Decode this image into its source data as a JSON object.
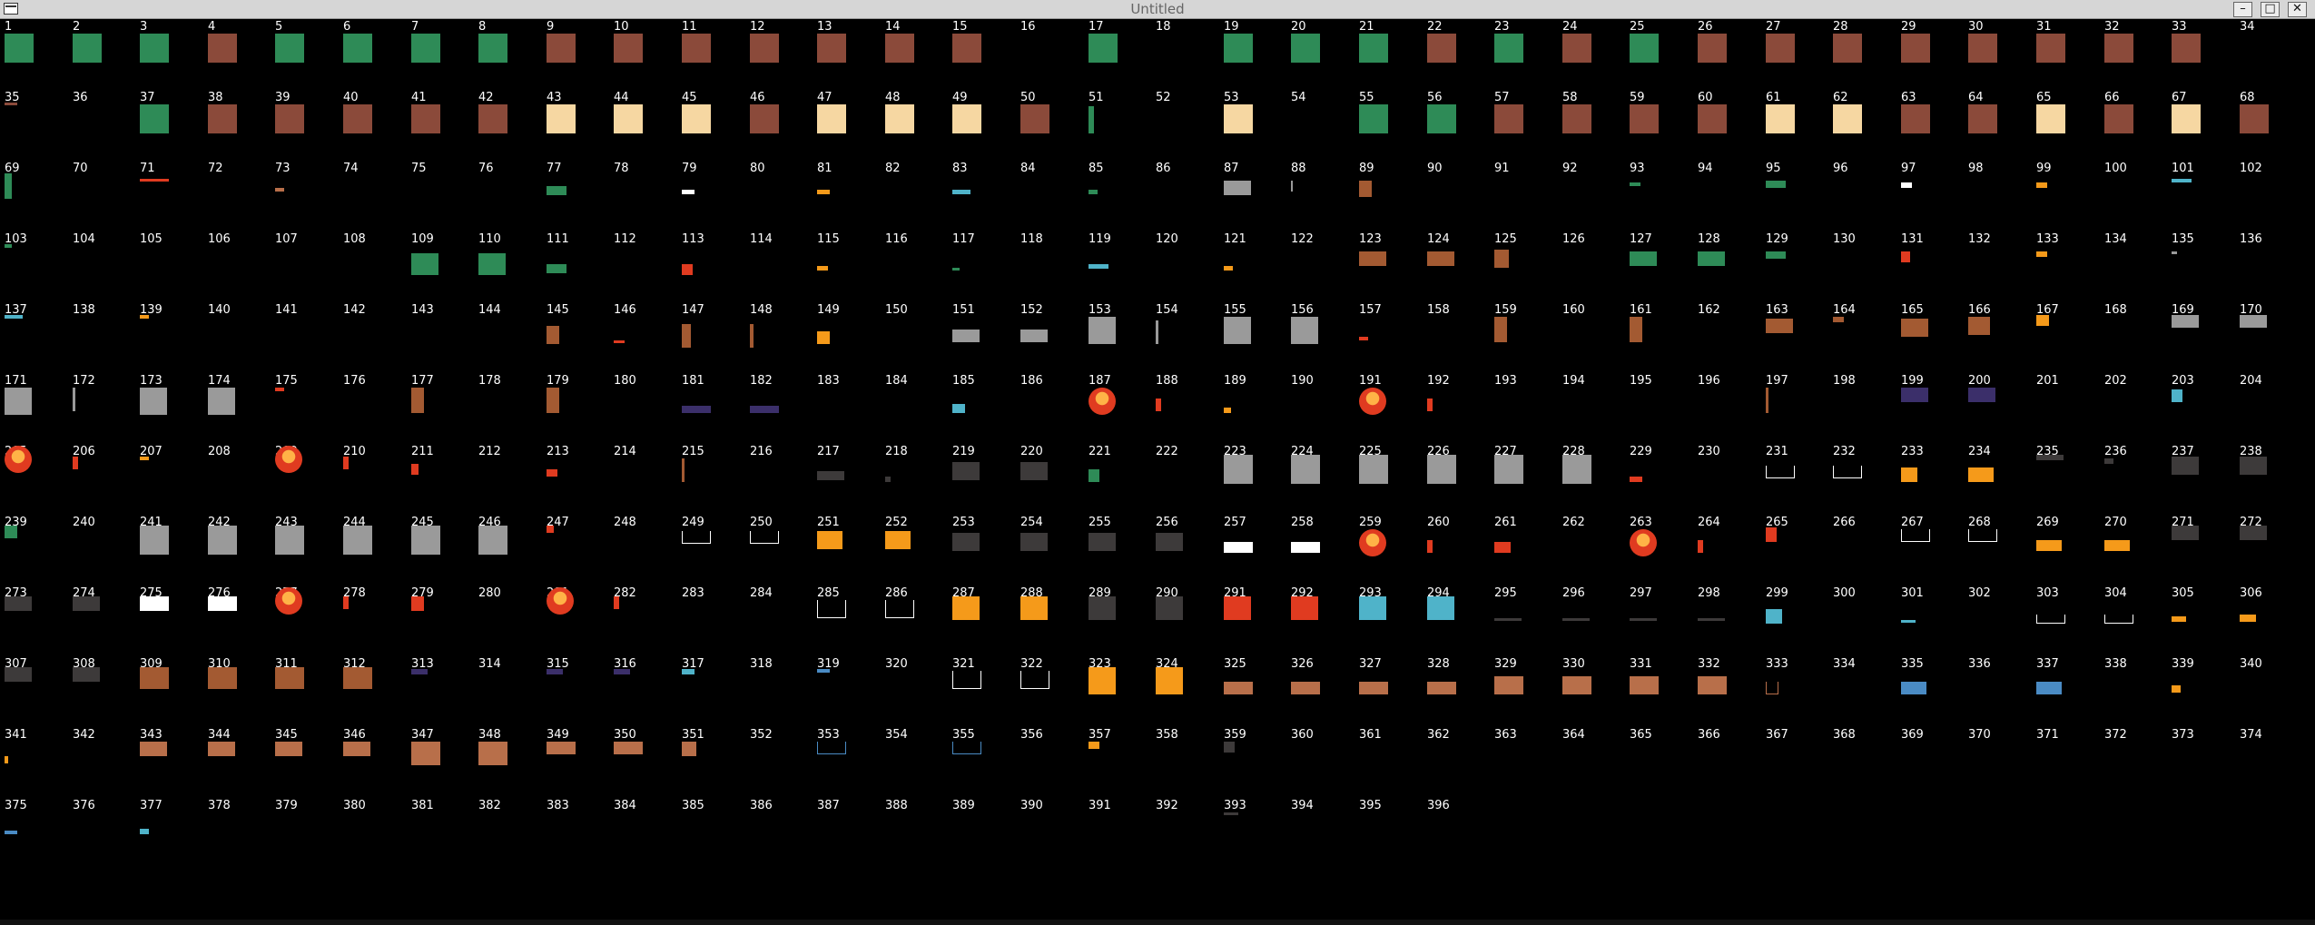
{
  "window": {
    "title": "Untitled",
    "controls": [
      "–",
      "□",
      "✕"
    ]
  },
  "grid": {
    "columns": 34,
    "rows": 12,
    "cell_labels": [
      "1",
      "2",
      "3",
      "4",
      "5",
      "6",
      "7",
      "8",
      "9",
      "10",
      "11",
      "12",
      "13",
      "14",
      "15",
      "16",
      "17",
      "18",
      "19",
      "20",
      "21",
      "22",
      "23",
      "24",
      "25",
      "26",
      "27",
      "28",
      "29",
      "30",
      "31",
      "32",
      "33",
      "34",
      "35",
      "36",
      "37",
      "38",
      "39",
      "40",
      "41",
      "42",
      "43",
      "44",
      "45",
      "46",
      "47",
      "48",
      "49",
      "50",
      "51",
      "52",
      "53",
      "54",
      "55",
      "56",
      "57",
      "58",
      "59",
      "60",
      "61",
      "62",
      "63",
      "64",
      "65",
      "66",
      "67",
      "68",
      "69",
      "70",
      "71",
      "72",
      "73",
      "74",
      "75",
      "76",
      "77",
      "78",
      "79",
      "80",
      "81",
      "82",
      "83",
      "84",
      "85",
      "86",
      "87",
      "88",
      "89",
      "90",
      "91",
      "92",
      "93",
      "94",
      "95",
      "96",
      "97",
      "98",
      "99",
      "100",
      "101",
      "102",
      "103",
      "104",
      "105",
      "106",
      "107",
      "108",
      "109",
      "110",
      "111",
      "112",
      "113",
      "114",
      "115",
      "116",
      "117",
      "118",
      "119",
      "120",
      "121",
      "122",
      "123",
      "124",
      "125",
      "126",
      "127",
      "128",
      "129",
      "130",
      "131",
      "132",
      "133",
      "134",
      "135",
      "136",
      "137",
      "138",
      "139",
      "140",
      "141",
      "142",
      "143",
      "144",
      "145",
      "146",
      "147",
      "148",
      "149",
      "150",
      "151",
      "152",
      "153",
      "154",
      "155",
      "156",
      "157",
      "158",
      "159",
      "160",
      "161",
      "162",
      "163",
      "164",
      "165",
      "166",
      "167",
      "168",
      "169",
      "170",
      "171",
      "172",
      "173",
      "174",
      "175",
      "176",
      "177",
      "178",
      "179",
      "180",
      "181",
      "182",
      "183",
      "184",
      "185",
      "186",
      "187",
      "188",
      "189",
      "190",
      "191",
      "192",
      "193",
      "194",
      "195",
      "196",
      "197",
      "198",
      "199",
      "200",
      "201",
      "202",
      "203",
      "204",
      "205",
      "206",
      "207",
      "208",
      "209",
      "210",
      "211",
      "212",
      "213",
      "214",
      "215",
      "216",
      "217",
      "218",
      "219",
      "220",
      "221",
      "222",
      "223",
      "224",
      "225",
      "226",
      "227",
      "228",
      "229",
      "230",
      "231",
      "232",
      "233",
      "234",
      "235",
      "236",
      "237",
      "238",
      "239",
      "240",
      "241",
      "242",
      "243",
      "244",
      "245",
      "246",
      "247",
      "248",
      "249",
      "250",
      "251",
      "252",
      "253",
      "254",
      "255",
      "256",
      "257",
      "258",
      "259",
      "260",
      "261",
      "262",
      "263",
      "264",
      "265",
      "266",
      "267",
      "268",
      "269",
      "270",
      "271",
      "272",
      "273",
      "274",
      "275",
      "276",
      "277",
      "278",
      "279",
      "280",
      "281",
      "282",
      "283",
      "284",
      "285",
      "286",
      "287",
      "288",
      "289",
      "290",
      "291",
      "292",
      "293",
      "294",
      "295",
      "296",
      "297",
      "298",
      "299",
      "300",
      "301",
      "302",
      "303",
      "304",
      "305",
      "306",
      "307",
      "308",
      "309",
      "310",
      "311",
      "312",
      "313",
      "314",
      "315",
      "316",
      "317",
      "318",
      "319",
      "320",
      "321",
      "322",
      "323",
      "324",
      "325",
      "326",
      "327",
      "328",
      "329",
      "330",
      "331",
      "332",
      "333",
      "334",
      "335",
      "336",
      "337",
      "338",
      "339",
      "340",
      "341",
      "342",
      "343",
      "344",
      "345",
      "346",
      "347",
      "348",
      "349",
      "350",
      "351",
      "352",
      "353",
      "354",
      "355",
      "356",
      "357",
      "358",
      "359",
      "360",
      "361",
      "362",
      "363",
      "364",
      "365",
      "366",
      "367",
      "368",
      "369",
      "370",
      "371",
      "372",
      "373",
      "374",
      "375",
      "376",
      "377",
      "378",
      "379",
      "380",
      "381",
      "382",
      "383",
      "384",
      "385",
      "386",
      "387",
      "388",
      "389",
      "390",
      "391",
      "392",
      "393",
      "394",
      "395",
      "396"
    ]
  },
  "palette": {
    "green": "#2e8b57",
    "brown": "#8b4a3a",
    "sand": "#f6d7a2",
    "wood": "#a35a32",
    "gray": "#9a9a9a",
    "dark": "#3d3a3a",
    "orange": "#f59a1a",
    "red": "#e03b20",
    "blue": "#4a8bc4",
    "teal": "#4fb3c9",
    "purple": "#3b2f6a",
    "white": "#ffffff",
    "tan": "#b86f4a"
  }
}
